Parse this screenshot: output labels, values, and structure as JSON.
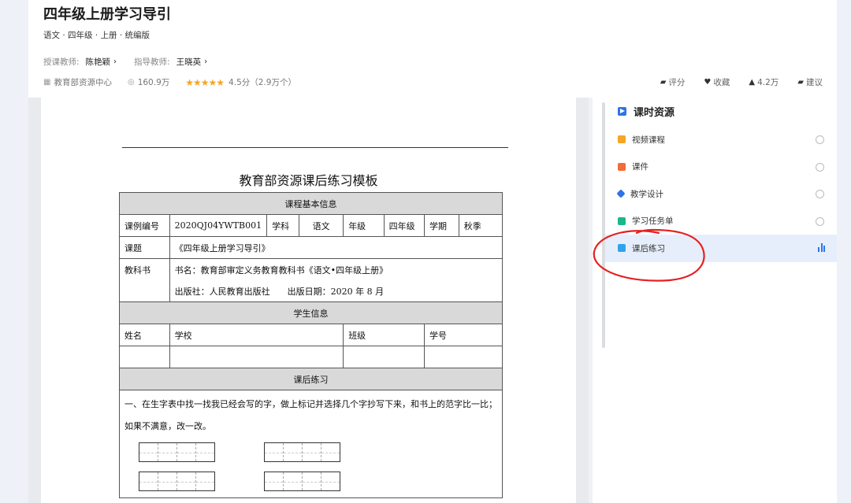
{
  "course": {
    "title": "四年级上册学习导引",
    "subtitle": "语文 · 四年级 · 上册 · 统编版",
    "teacher_label": "授课教师:",
    "teacher_name": "陈艳颖",
    "guide_label": "指导教师:",
    "guide_name": "王晓英",
    "source": "教育部资源中心",
    "views": "160.9万",
    "rating_stars": "★★★★★",
    "rating": "4.5分（2.9万个）"
  },
  "actions": {
    "rate": "评分",
    "favorite": "收藏",
    "likes": "4.2万",
    "suggest": "建议"
  },
  "document": {
    "title": "教育部资源课后练习模板",
    "sec_basic": "课程基本信息",
    "lbl_code": "课例编号",
    "code": "2020QJ04YWTB001",
    "lbl_subject": "学科",
    "subject": "语文",
    "lbl_grade": "年级",
    "grade": "四年级",
    "lbl_term": "学期",
    "term": "秋季",
    "lbl_topic": "课题",
    "topic": "《四年级上册学习导引》",
    "lbl_textbook": "教科书",
    "textbook": "书名：教育部审定义务教育教科书《语文•四年级上册》",
    "publisher": "出版社：人民教育出版社　　出版日期：2020 年 8 月",
    "sec_student": "学生信息",
    "lbl_name": "姓名",
    "lbl_school": "学校",
    "lbl_class": "班级",
    "lbl_id": "学号",
    "sec_exercise": "课后练习",
    "exercise_1": "一、在生字表中找一找我已经会写的字，做上标记并选择几个字抄写下来，和书上的范字比一比；如果不满意，改一改。"
  },
  "sidebar": {
    "title": "课时资源",
    "items": [
      {
        "label": "视频课程",
        "icon": "video-icon",
        "color": "#f5a623"
      },
      {
        "label": "课件",
        "icon": "slides-icon",
        "color": "#f26b3a"
      },
      {
        "label": "教学设计",
        "icon": "design-icon",
        "color": "#2f73e8"
      },
      {
        "label": "学习任务单",
        "icon": "task-icon",
        "color": "#19b88a"
      },
      {
        "label": "课后练习",
        "icon": "exercise-icon",
        "color": "#2fa4e8",
        "active": true
      }
    ]
  },
  "colors": {
    "accent": "#2f73e8",
    "annotation": "#e62020",
    "star": "#f5a623"
  }
}
